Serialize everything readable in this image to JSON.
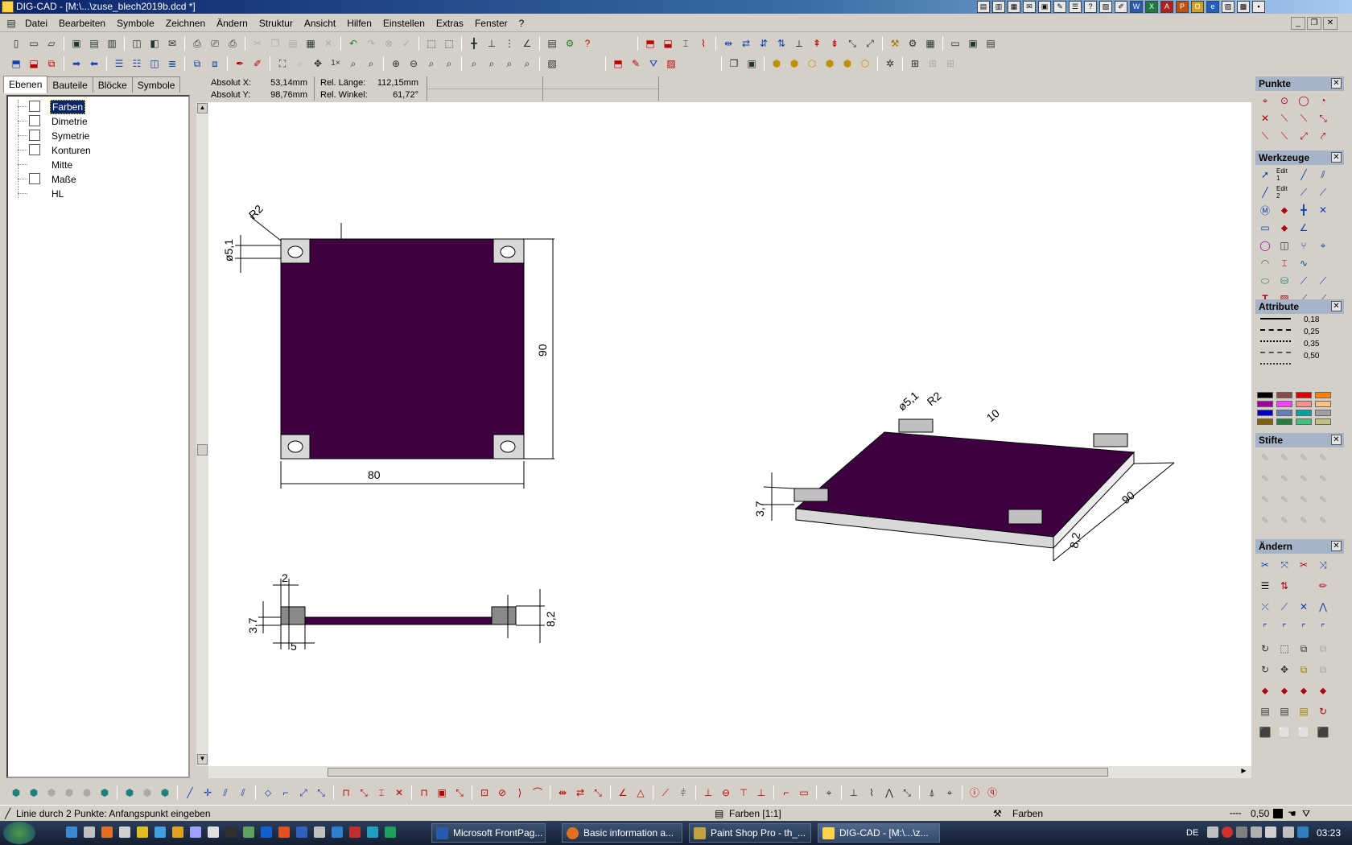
{
  "titlebar": {
    "title": "DIG-CAD - [M:\\...\\zuse_blech2019b.dcd *]"
  },
  "menu": [
    "Datei",
    "Bearbeiten",
    "Symbole",
    "Zeichnen",
    "Ändern",
    "Struktur",
    "Ansicht",
    "Hilfen",
    "Einstellen",
    "Extras",
    "Fenster",
    "?"
  ],
  "tree": {
    "tabs": [
      "Ebenen",
      "Bauteile",
      "Blöcke",
      "Symbole"
    ],
    "layers": [
      "Farben",
      "Dimetrie",
      "Symetrie",
      "Konturen",
      "Mitte",
      "Maße",
      "HL"
    ]
  },
  "coords": {
    "abs_x_label": "Absolut X:",
    "abs_x": "53,14mm",
    "abs_y_label": "Absolut Y:",
    "abs_y": "98,76mm",
    "len_label": "Rel. Länge:",
    "len": "112,15mm",
    "angle_label": "Rel. Winkel:",
    "angle": "61,72°"
  },
  "panels": {
    "punkte": "Punkte",
    "werkzeuge": "Werkzeuge",
    "attribute": "Attribute",
    "stifte": "Stifte",
    "aendern": "Ändern",
    "edit1": "Edit 1",
    "edit2": "Edit 2"
  },
  "line_widths": [
    "0,18",
    "0,25",
    "0,35",
    "0,50"
  ],
  "palette": [
    "#000000",
    "#8b4a4a",
    "#e00000",
    "#ff8000",
    "#a000a0",
    "#ff40ff",
    "#ff9090",
    "#ffc080",
    "#0000c0",
    "#6080c0",
    "#00a0a0",
    "#a0a0a0",
    "#806000",
    "#208040",
    "#40c080",
    "#c0c080"
  ],
  "drawing": {
    "plate_color": "#3d0041",
    "dim_top_r": "R2",
    "dim_top_d": "ø5,1",
    "dim_width": "80",
    "dim_height": "90",
    "side_thick_top": "2",
    "side_h": "3,7",
    "side_w": "5",
    "side_h2": "8,2",
    "iso_d": "ø5,1",
    "iso_r": "R2",
    "iso_10": "10",
    "iso_90": "90",
    "iso_37": "3,7",
    "iso_82": "8,2"
  },
  "status": {
    "message": "Linie durch 2 Punkte: Anfangspunkt eingeben",
    "layer": "Farben [1:1]",
    "layer2": "Farben",
    "linewidth": "0,50"
  },
  "taskbar": {
    "lang": "DE",
    "clock": "03:23",
    "tasks": [
      "Microsoft FrontPag...",
      "Basic information a...",
      "Paint Shop Pro - th_...",
      "DIG-CAD - [M:\\...\\z..."
    ]
  }
}
